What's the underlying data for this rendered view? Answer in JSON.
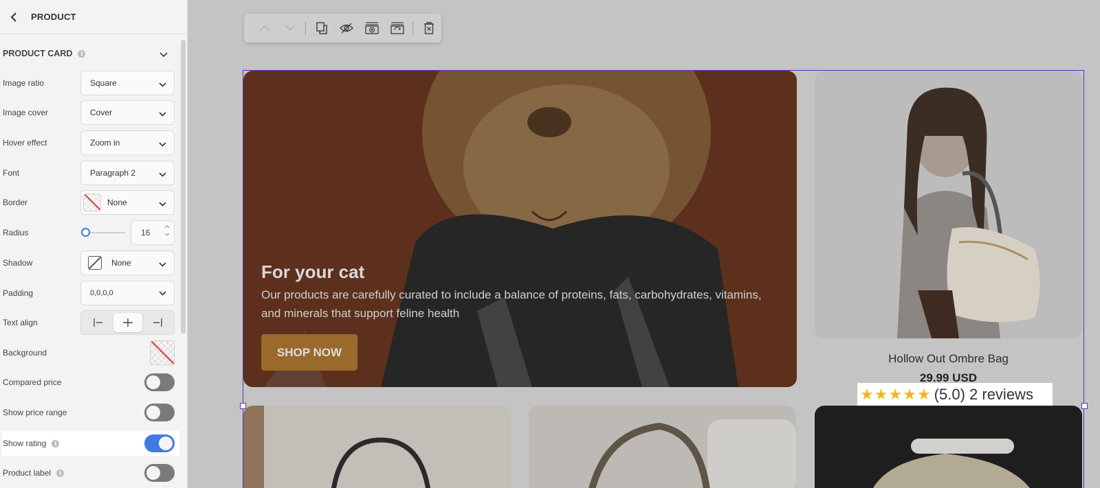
{
  "sidebar": {
    "title": "PRODUCT",
    "section_title": "PRODUCT CARD",
    "image_ratio": {
      "label": "Image ratio",
      "value": "Square"
    },
    "image_cover": {
      "label": "Image cover",
      "value": "Cover"
    },
    "hover_effect": {
      "label": "Hover effect",
      "value": "Zoom in"
    },
    "font": {
      "label": "Font",
      "value": "Paragraph 2"
    },
    "border": {
      "label": "Border",
      "value": "None"
    },
    "radius": {
      "label": "Radius",
      "value": "16",
      "slider_fraction": 0.0
    },
    "shadow": {
      "label": "Shadow",
      "value": "None"
    },
    "padding": {
      "label": "Padding",
      "value": "0,0,0,0"
    },
    "text_align": {
      "label": "Text align",
      "selected": "center"
    },
    "background": {
      "label": "Background"
    },
    "compared_price": {
      "label": "Compared price",
      "on": false
    },
    "show_price_range": {
      "label": "Show price range",
      "on": false
    },
    "show_rating": {
      "label": "Show rating",
      "on": true
    },
    "product_label": {
      "label": "Product label",
      "on": false
    }
  },
  "toolbar": {
    "icons": [
      "chevron-up-icon",
      "chevron-down-icon",
      "duplicate-icon",
      "hide-icon",
      "add-section-icon",
      "replace-icon",
      "delete-icon"
    ]
  },
  "banner": {
    "title": "For your cat",
    "text": "Our products are carefully curated to include a balance of proteins, fats, carbohydrates, vitamins, and minerals that support feline health",
    "button": "SHOP NOW"
  },
  "product": {
    "name": "Hollow Out Ombre Bag",
    "price": "29.99 USD",
    "rating_text": "(5.0) 2 reviews",
    "stars": 5
  },
  "colors": {
    "accent": "#3f7be0",
    "selection": "#5a2ec2",
    "star": "#f3b51b"
  }
}
